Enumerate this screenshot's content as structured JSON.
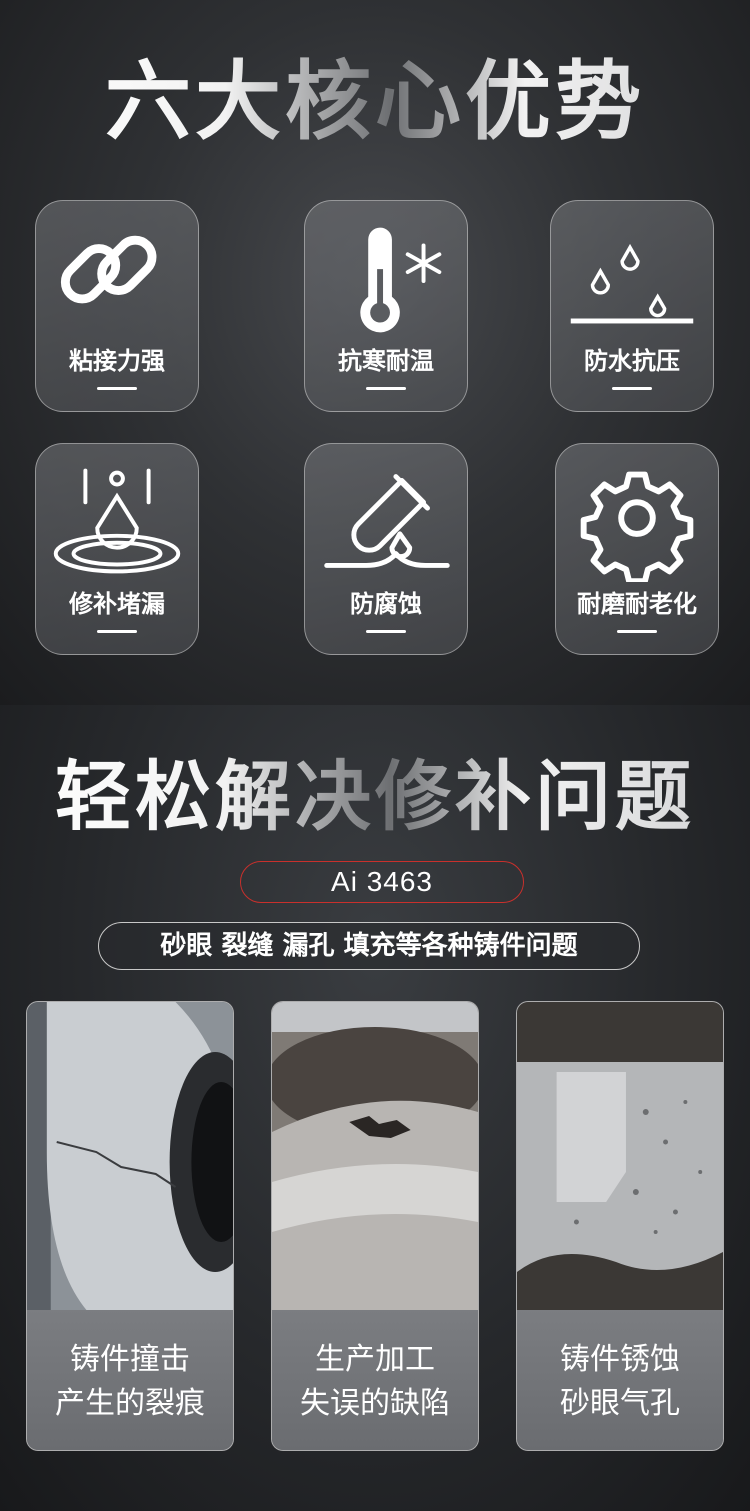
{
  "advantages": {
    "title": "六大核心优势",
    "items": [
      {
        "label": "粘接力强",
        "icon": "link-icon"
      },
      {
        "label": "抗寒耐温",
        "icon": "thermometer-snowflake-icon"
      },
      {
        "label": "防水抗压",
        "icon": "water-drops-icon"
      },
      {
        "label": "修补堵漏",
        "icon": "drop-ripple-icon"
      },
      {
        "label": "防腐蚀",
        "icon": "test-tube-icon"
      },
      {
        "label": "耐磨耐老化",
        "icon": "gear-icon"
      }
    ]
  },
  "solutions": {
    "title": "轻松解决修补问题",
    "product": "Ai 3463",
    "subtitle": "砂眼 裂缝 漏孔 填充等各种铸件问题",
    "cases": [
      {
        "line1": "铸件撞击",
        "line2": "产生的裂痕"
      },
      {
        "line1": "生产加工",
        "line2": "失误的缺陷"
      },
      {
        "line1": "铸件锈蚀",
        "line2": "砂眼气孔"
      }
    ]
  },
  "colors": {
    "pill_border": "#c9302c",
    "text": "#ffffff"
  }
}
